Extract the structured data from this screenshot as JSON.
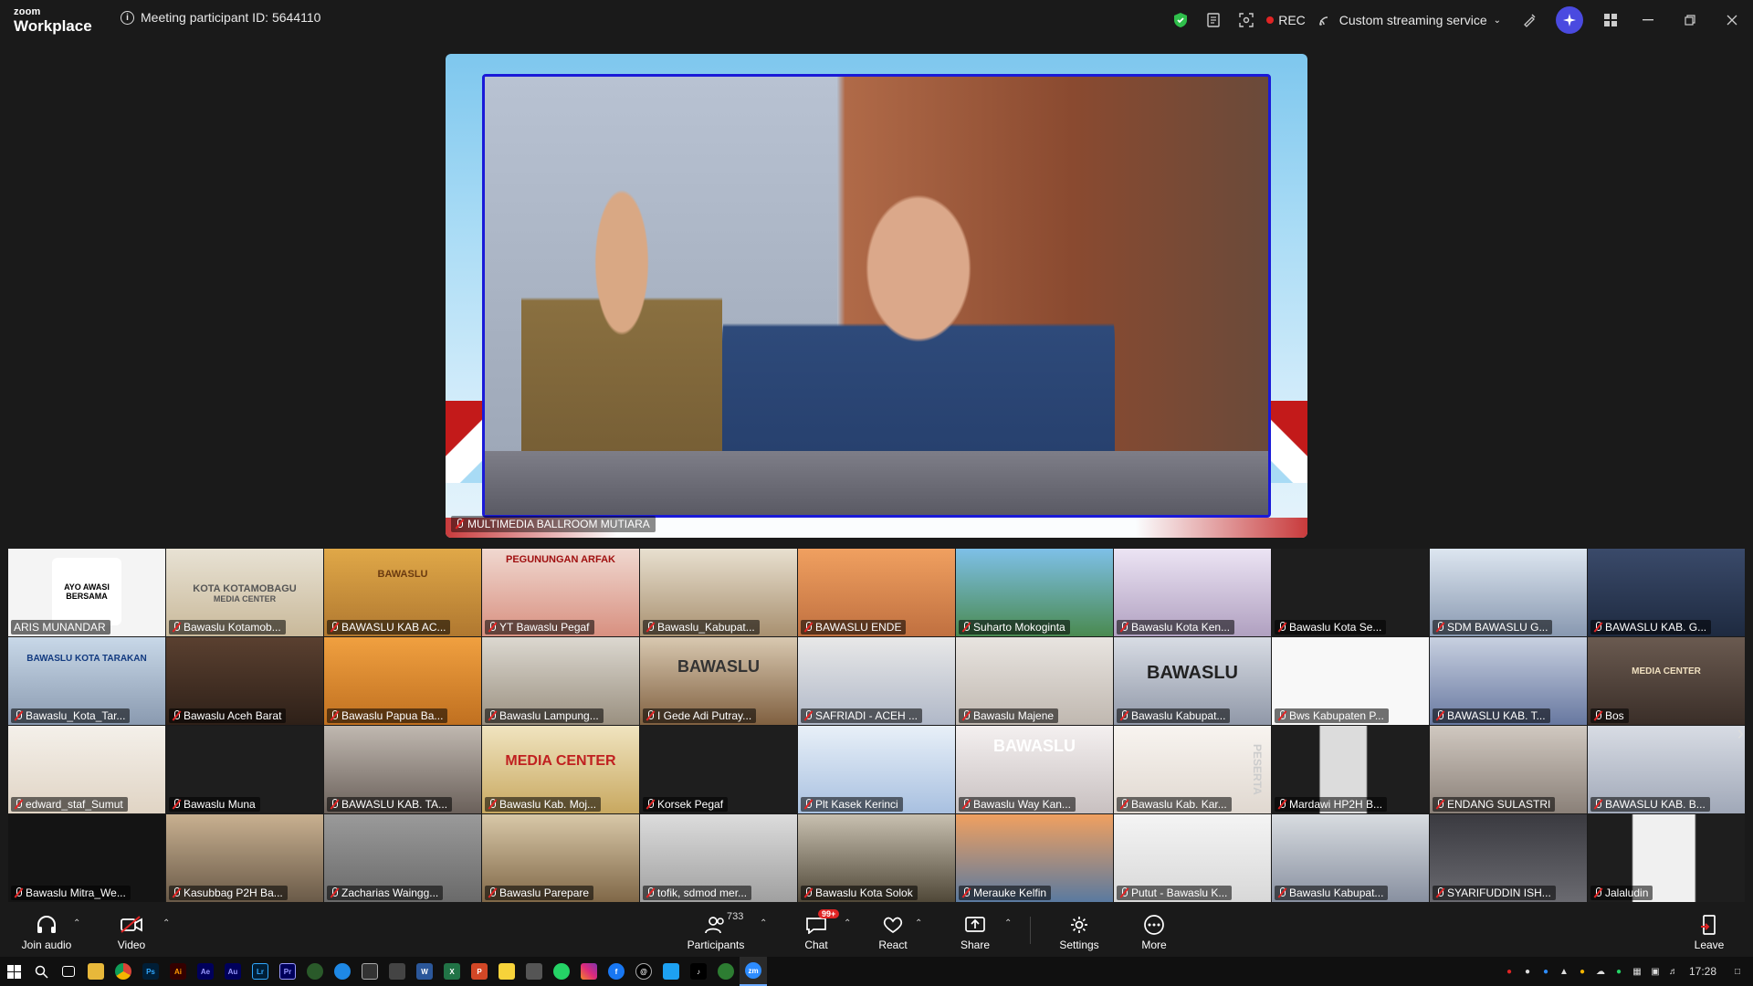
{
  "app": {
    "brand_small": "zoom",
    "brand_big": "Workplace"
  },
  "meeting": {
    "participant_id": "Meeting participant ID: 5644110"
  },
  "topbar": {
    "rec_label": "REC",
    "streaming_label": "Custom streaming service"
  },
  "speaker": {
    "name": "MULTIMEDIA BALLROOM MUTIARA"
  },
  "gallery": [
    "ARIS MUNANDAR",
    "Bawaslu Kotamob...",
    "BAWASLU KAB AC...",
    "YT Bawaslu Pegaf",
    "Bawaslu_Kabupat...",
    "BAWASLU ENDE",
    "Suharto Mokoginta",
    "Bawaslu Kota Ken...",
    "Bawaslu Kota Se...",
    "SDM BAWASLU G...",
    "BAWASLU KAB. G...",
    "Bawaslu_Kota_Tar...",
    "Bawaslu Aceh Barat",
    "Bawaslu Papua Ba...",
    "Bawaslu Lampung...",
    "I Gede Adi Putray...",
    "SAFRIADI - ACEH ...",
    "Bawaslu Majene",
    "Bawaslu Kabupat...",
    "Bws Kabupaten P...",
    "BAWASLU KAB. T...",
    "Bos",
    "edward_staf_Sumut",
    "Bawaslu Muna",
    "BAWASLU KAB. TA...",
    "Bawaslu Kab. Moj...",
    "Korsek Pegaf",
    "Plt Kasek Kerinci",
    "Bawaslu Way Kan...",
    "Bawaslu Kab. Kar...",
    "Mardawi HP2H B...",
    "ENDANG SULASTRI",
    "BAWASLU KAB. B...",
    "Bawaslu Mitra_We...",
    "Kasubbag P2H Ba...",
    "Zacharias Waingg...",
    "Bawaslu Parepare",
    "tofik, sdmod mer...",
    "Bawaslu Kota Solok",
    "Merauke Kelfin",
    "Putut - Bawaslu K...",
    "Bawaslu Kabupat...",
    "SYARIFUDDIN ISH...",
    "Jalaludin"
  ],
  "tile_text": {
    "ayo": "AYO AWASI BERSAMA",
    "kotamobagu": "KOTA KOTAMOBAGU",
    "kotamobagu_sub": "MEDIA CENTER",
    "bawaslu": "BAWASLU",
    "arfak": "PEGUNUNGAN ARFAK",
    "tarakan": "BAWASLU KOTA TARAKAN",
    "media_center": "MEDIA CENTER",
    "peserta": "PESERTA"
  },
  "toolbar": {
    "join_audio": "Join audio",
    "video": "Video",
    "participants": "Participants",
    "participants_count": "733",
    "chat": "Chat",
    "chat_badge": "99+",
    "react": "React",
    "share": "Share",
    "settings": "Settings",
    "more": "More",
    "leave": "Leave"
  },
  "taskbar": {
    "time": "17:28"
  },
  "colors": {
    "background": "#1a1a1a",
    "rec_red": "#e02424",
    "speaker_border": "#1a1ad8",
    "ai_button": "#4a4ae0",
    "shield_green": "#2fbf4b"
  }
}
